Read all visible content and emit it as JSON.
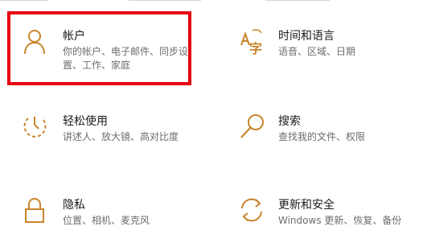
{
  "accent_color": "#c8852a",
  "highlight_color": "#e60012",
  "tiles": [
    {
      "title": "帐户",
      "desc": "你的帐户、电子邮件、同步设置、工作、家庭",
      "icon": "person-icon"
    },
    {
      "title": "时间和语言",
      "desc": "语音、区域、日期",
      "icon": "time-language-icon"
    },
    {
      "title": "轻松使用",
      "desc": "讲述人、放大镜、高对比度",
      "icon": "ease-of-access-icon"
    },
    {
      "title": "搜索",
      "desc": "查找我的文件、权限",
      "icon": "search-icon"
    },
    {
      "title": "隐私",
      "desc": "位置、相机、麦克风",
      "icon": "lock-icon"
    },
    {
      "title": "更新和安全",
      "desc": "Windows 更新、恢复、备份",
      "icon": "update-sync-icon"
    }
  ]
}
